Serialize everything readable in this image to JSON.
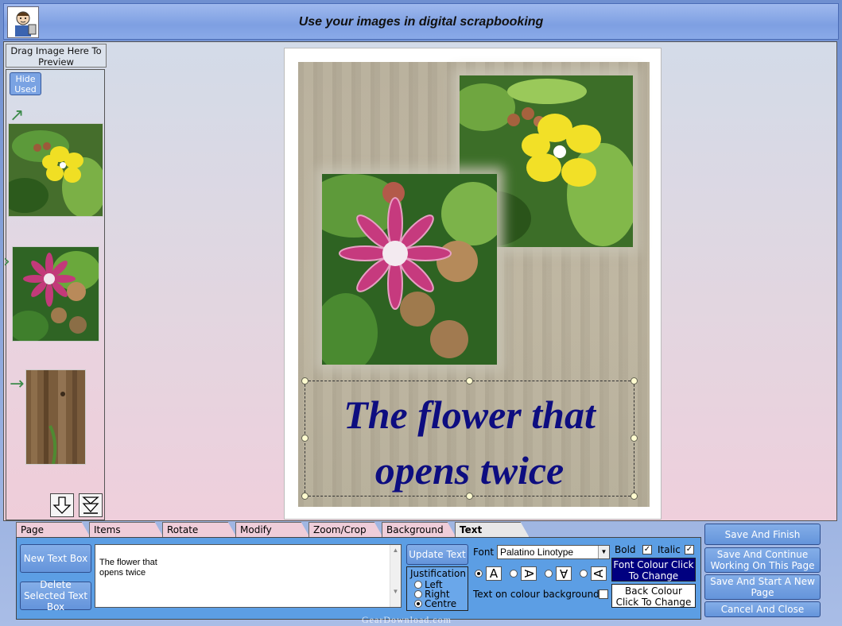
{
  "window": {
    "title": "Use your images in digital scrapbooking"
  },
  "sidebar": {
    "header": "Drag Image Here To Preview",
    "hide_used": "Hide Used"
  },
  "canvas": {
    "page_text": "The flower that opens twice"
  },
  "tabs": [
    {
      "label": "Page"
    },
    {
      "label": "Items"
    },
    {
      "label": "Rotate"
    },
    {
      "label": "Modify"
    },
    {
      "label": "Zoom/Crop"
    },
    {
      "label": "Background"
    },
    {
      "label": "Text",
      "active": true
    }
  ],
  "text_panel": {
    "new_text_box": "New Text Box",
    "delete_text_box": "Delete Selected Text Box",
    "text_value": "The flower that\nopens twice",
    "update_text": "Update Text",
    "justification": {
      "title": "Justification",
      "options": [
        "Left",
        "Right",
        "Centre"
      ],
      "selected": "Centre"
    },
    "font_label": "Font",
    "font_value": "Palatino Linotype",
    "bold_label": "Bold",
    "bold_checked": true,
    "italic_label": "Italic",
    "italic_checked": true,
    "font_colour": "Font Colour Click To Change",
    "font_colour_hex": "#000080",
    "text_on_colour": "Text on colour background",
    "back_colour": "Back Colour Click To Change",
    "back_colour_hex": "#ffffff"
  },
  "actions": {
    "save_finish": "Save And Finish",
    "save_continue": "Save And Continue Working On This Page",
    "save_new": "Save And Start A New Page",
    "cancel": "Cancel And Close"
  },
  "watermark": "GearDownload.com"
}
